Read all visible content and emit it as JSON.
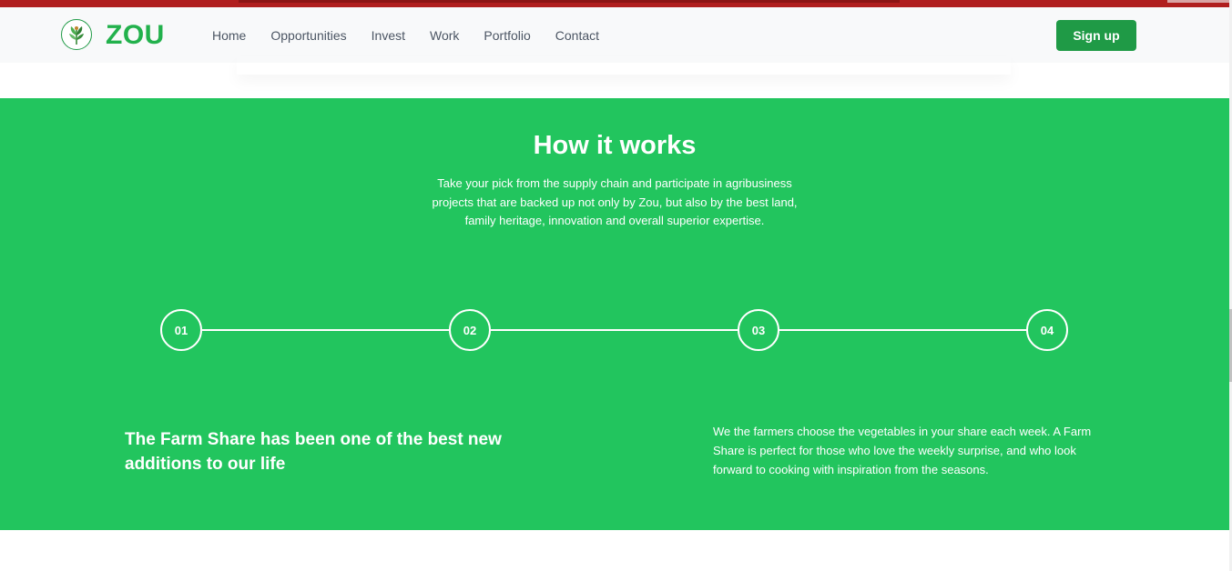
{
  "nav": {
    "brand": "ZOU",
    "links": [
      "Home",
      "Opportunities",
      "Invest",
      "Work",
      "Portfolio",
      "Contact"
    ],
    "signup_label": "Sign up"
  },
  "section": {
    "title": "How it works",
    "description": "Take your pick from the supply chain and participate in agribusiness projects that are backed up not only by Zou, but also by the best land, family heritage, innovation and overall superior expertise.",
    "steps": [
      "01",
      "02",
      "03",
      "04"
    ],
    "quote": "The Farm Share has been one of the best new additions to our life",
    "text": "We the farmers choose the vegetables in your share each week. A Farm Share is perfect for those who love the weekly surprise, and who look forward to cooking with inspiration from the seasons."
  },
  "colors": {
    "brand_green": "#22b14c",
    "section_green": "#22c55e",
    "button_green": "#1f9a46",
    "top_bar_red": "#b01e1e"
  }
}
